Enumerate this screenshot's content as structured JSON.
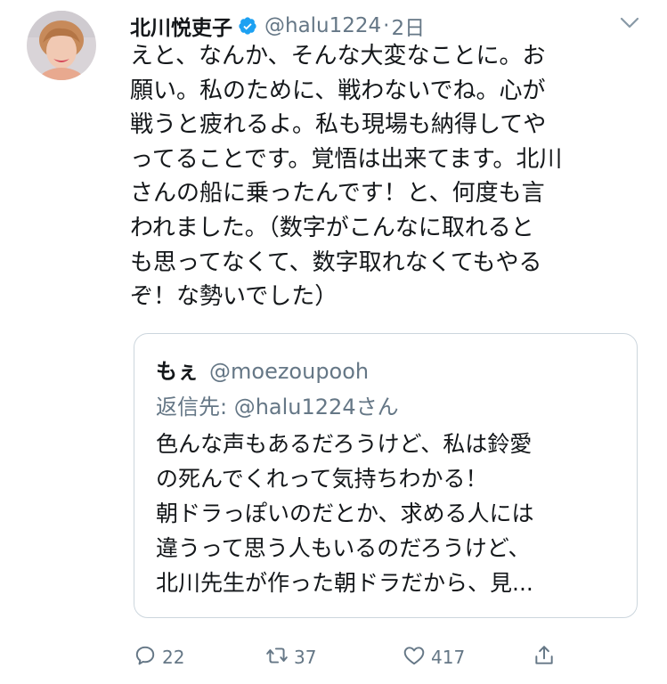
{
  "tweet": {
    "author_name": "北川悦吏子",
    "handle": "@halu1224",
    "separator": "·",
    "time": "2日",
    "text": "えと、なんか、そんな大変なことに。お\n願い。私のために、戦わないでね。心が\n戦うと疲れるよ。私も現場も納得してや\nってることです。覚悟は出来てます。北川\nさんの船に乗ったんです！と、何度も言\nわれました。（数字がこんなに取れると\nも思ってなくて、数字取れなくてもやる\nぞ！な勢いでした）"
  },
  "quote": {
    "author_name": "もぇ",
    "handle": "@moezoupooh",
    "reply_to": "返信先: @halu1224さん",
    "text": "色んな声もあるだろうけど、私は鈴愛\nの死んでくれって気持ちわかる！\n朝ドラっぽいのだとか、求める人には\n違うって思う人もいるのだろうけど、\n北川先生が作った朝ドラだから、見..."
  },
  "actions": {
    "reply_count": "22",
    "retweet_count": "37",
    "like_count": "417"
  },
  "colors": {
    "verified": "#1da1f2",
    "secondary_text": "#657786",
    "border": "#ccd6dd"
  },
  "icons": [
    "verified-badge-icon",
    "chevron-down-icon",
    "reply-icon",
    "retweet-icon",
    "like-icon",
    "share-icon"
  ]
}
